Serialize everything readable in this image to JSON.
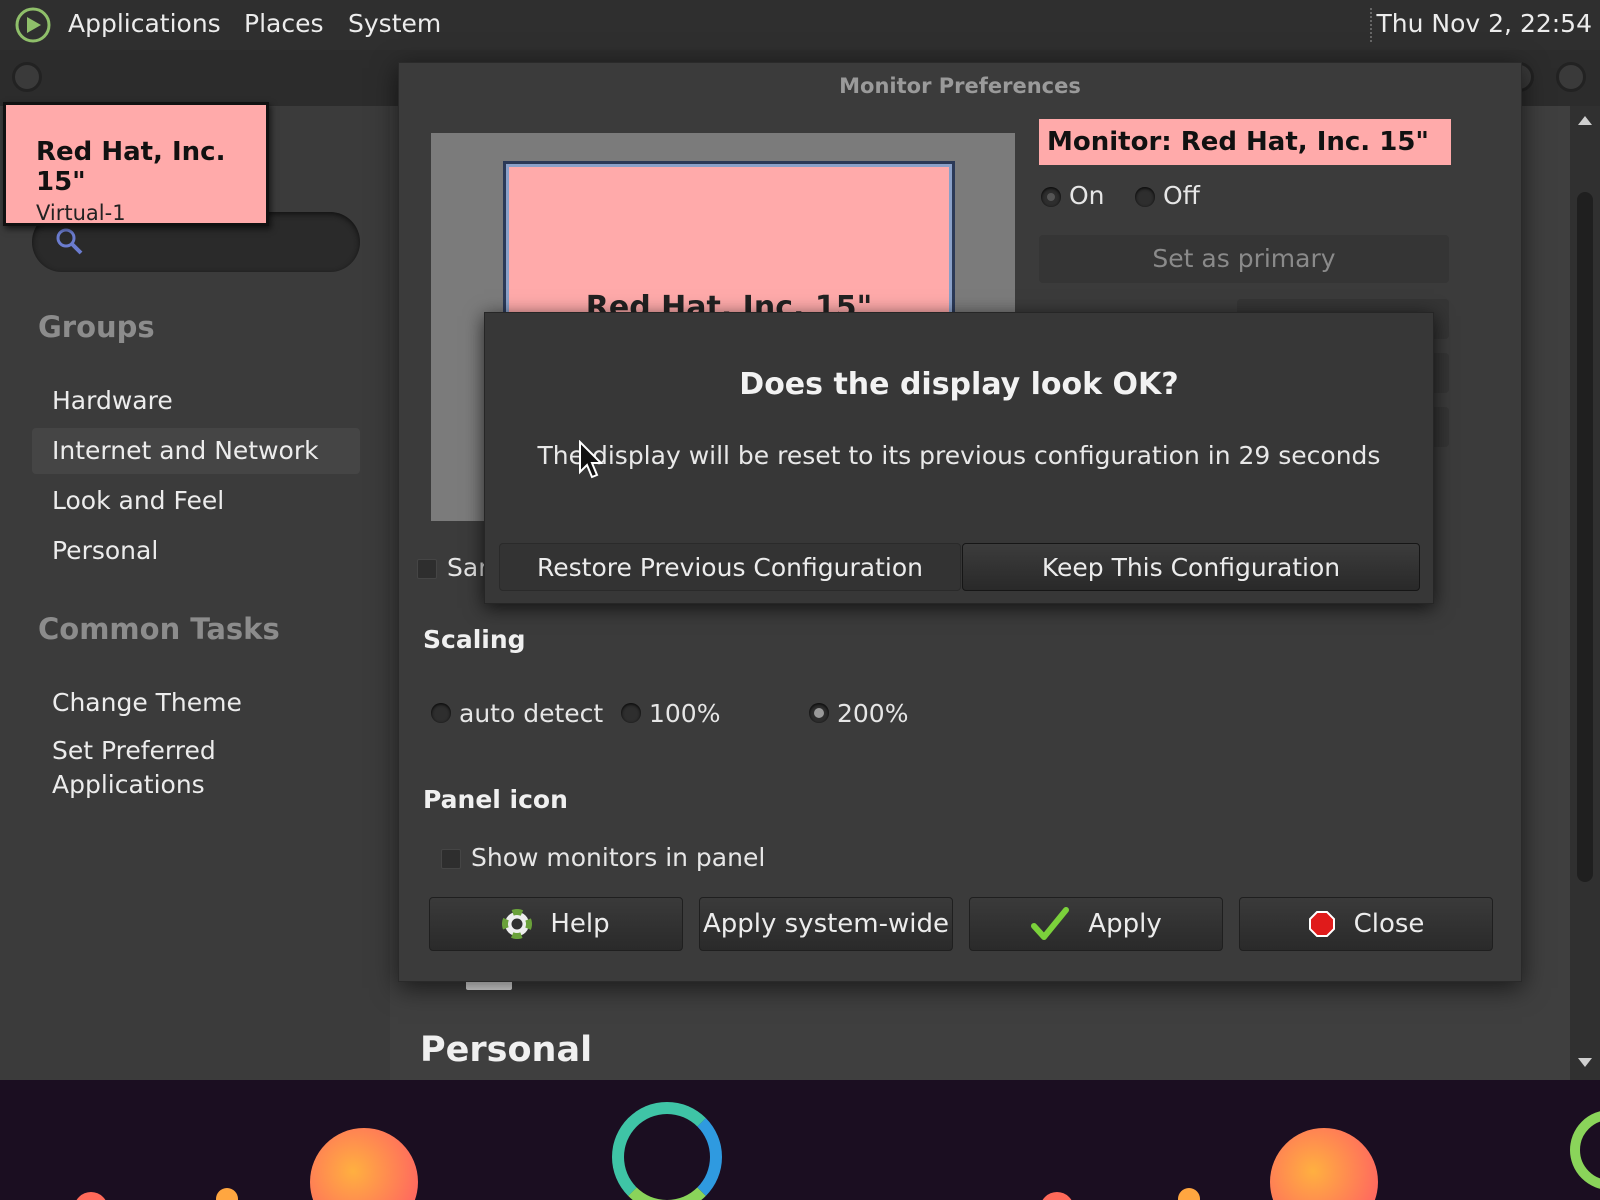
{
  "top_panel": {
    "menus": [
      "Applications",
      "Places",
      "System"
    ],
    "clock": "Thu Nov  2, 22:54"
  },
  "control_center": {
    "groups_heading": "Groups",
    "groups": [
      "Hardware",
      "Internet and Network",
      "Look and Feel",
      "Personal"
    ],
    "tasks_heading": "Common Tasks",
    "tasks": [
      "Change Theme",
      "Set Preferred Applications"
    ],
    "section_title": "Personal"
  },
  "tooltip": {
    "title": "Red Hat, Inc. 15\"",
    "subtitle": "Virtual-1"
  },
  "monitor_prefs": {
    "title": "Monitor Preferences",
    "canvas_monitor_label": "Red Hat, Inc. 15\"",
    "monitor_heading": "Monitor: Red Hat, Inc. 15\"",
    "power_on": "On",
    "power_off": "Off",
    "set_primary": "Set as primary",
    "same_image_label": "Sar",
    "scaling_heading": "Scaling",
    "scaling_options": [
      "auto detect",
      "100%",
      "200%"
    ],
    "scaling_selected": "200%",
    "panel_icon_heading": "Panel icon",
    "show_in_panel": "Show monitors in panel",
    "buttons": {
      "help": "Help",
      "apply_system_wide": "Apply system-wide",
      "apply": "Apply",
      "close": "Close"
    }
  },
  "confirm_dialog": {
    "title": "Does the display look OK?",
    "message": "The display will be reset to its previous configuration in 29 seconds",
    "restore": "Restore Previous Configuration",
    "keep": "Keep This Configuration"
  },
  "colors": {
    "highlight_pink": "#ffaaaa",
    "panel_bg": "#2f2f2f",
    "window_bg": "#3b3b3b"
  }
}
